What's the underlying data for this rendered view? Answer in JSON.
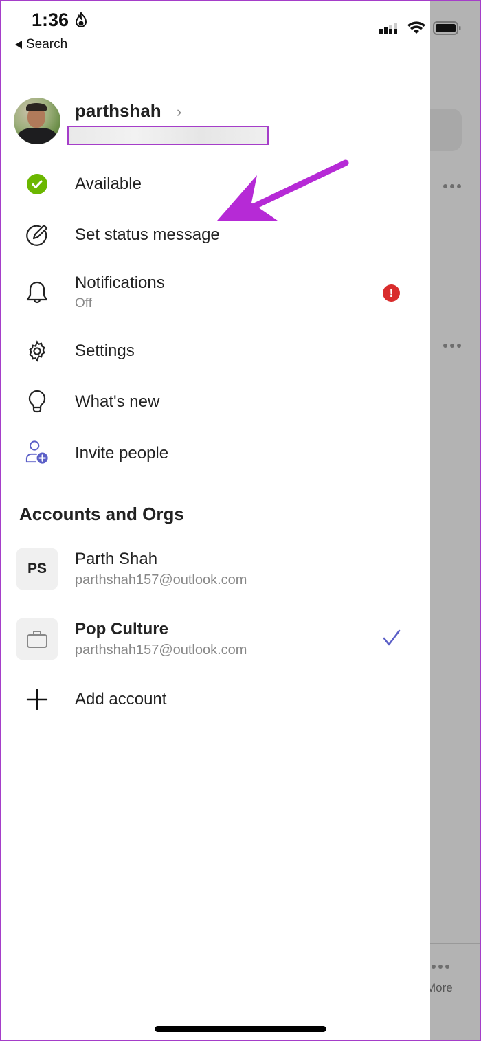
{
  "status_bar": {
    "time": "1:36",
    "back_label": "Search"
  },
  "profile": {
    "username": "parthshah",
    "chevron": "›",
    "redacted_email": ""
  },
  "menu": [
    {
      "label": "Available",
      "icon": "presence-available-icon"
    },
    {
      "label": "Set status message",
      "icon": "edit-status-icon"
    },
    {
      "label": "Notifications",
      "sublabel": "Off",
      "icon": "bell-icon",
      "badge": "!"
    },
    {
      "label": "Settings",
      "icon": "gear-icon"
    },
    {
      "label": "What's new",
      "icon": "lightbulb-icon"
    },
    {
      "label": "Invite people",
      "icon": "person-add-icon"
    }
  ],
  "accounts": {
    "title": "Accounts and Orgs",
    "items": [
      {
        "initials": "PS",
        "name": "Parth Shah",
        "email": "parthshah157@outlook.com",
        "selected": false
      },
      {
        "name": "Pop Culture",
        "email": "parthshah157@outlook.com",
        "selected": true
      }
    ],
    "add_label": "Add account"
  },
  "background": {
    "more_label": "More"
  },
  "colors": {
    "accent": "#5b5fc7",
    "available": "#6bb700",
    "alert": "#d92c2c",
    "annotation": "#a53ec9"
  }
}
